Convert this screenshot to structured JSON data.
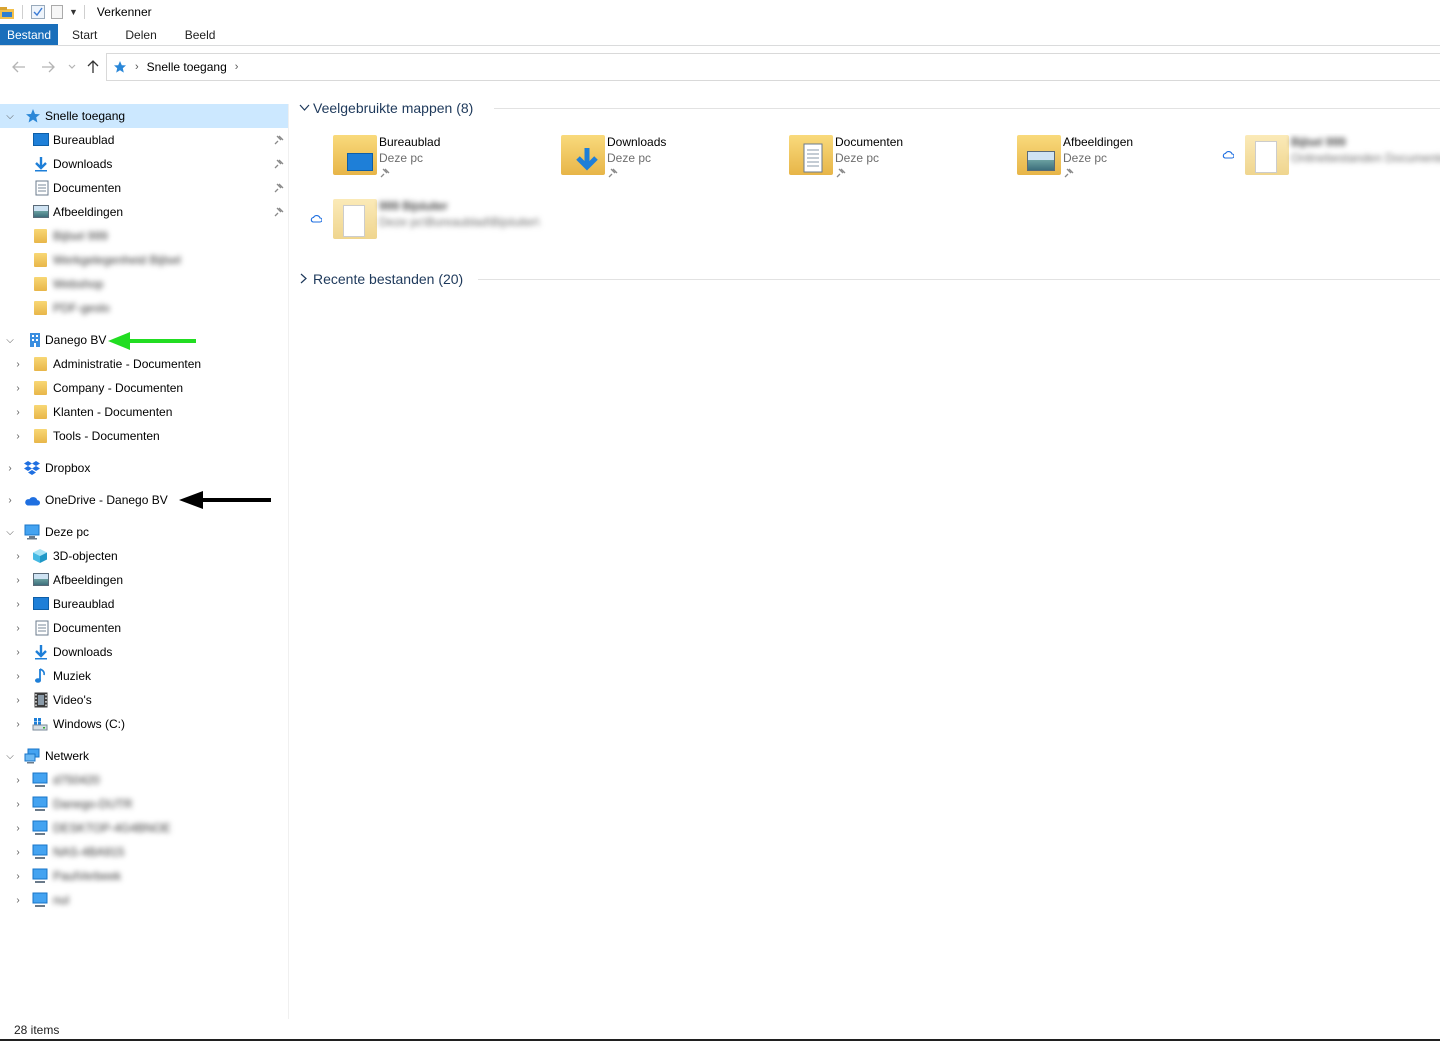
{
  "window": {
    "title": "Verkenner"
  },
  "ribbon": {
    "tabs": [
      "Bestand",
      "Start",
      "Delen",
      "Beeld"
    ]
  },
  "address": {
    "crumb": "Snelle toegang"
  },
  "nav": {
    "quick_access": "Snelle toegang",
    "quick_items": [
      {
        "label": "Bureaublad",
        "icon": "desktop-icon",
        "pinned": true
      },
      {
        "label": "Downloads",
        "icon": "downloads-icon",
        "pinned": true
      },
      {
        "label": "Documenten",
        "icon": "documents-icon",
        "pinned": true
      },
      {
        "label": "Afbeeldingen",
        "icon": "pictures-icon",
        "pinned": true
      },
      {
        "label": "Bijlsel 999",
        "icon": "folder-icon",
        "pinned": false
      },
      {
        "label": "Werkgelegenheid Bijlsel",
        "icon": "folder-icon",
        "pinned": false
      },
      {
        "label": "Webshop",
        "icon": "folder-icon",
        "pinned": false
      },
      {
        "label": "PDF-geslo",
        "icon": "folder-icon",
        "pinned": false
      }
    ],
    "org": "Danego BV",
    "org_items": [
      "Administratie - Documenten",
      "Company - Documenten",
      "Klanten - Documenten",
      "Tools - Documenten"
    ],
    "dropbox": "Dropbox",
    "onedrive": "OneDrive - Danego BV",
    "this_pc": "Deze pc",
    "pc_items": [
      "3D-objecten",
      "Afbeeldingen",
      "Bureaublad",
      "Documenten",
      "Downloads",
      "Muziek",
      "Video's",
      "Windows (C:)"
    ],
    "network": "Netwerk",
    "network_items": [
      "d750420",
      "Danego-DUTR",
      "DESKTOP-4G4BNOE",
      "NAS-4BA915",
      "PaulVerbeek",
      "nul"
    ]
  },
  "content": {
    "frequent_header": "Veelgebruikte mappen (8)",
    "recent_header": "Recente bestanden (20)",
    "frequent": [
      {
        "name": "Bureaublad",
        "sub": "Deze pc",
        "pinned": true
      },
      {
        "name": "Downloads",
        "sub": "Deze pc",
        "pinned": true
      },
      {
        "name": "Documenten",
        "sub": "Deze pc",
        "pinned": true
      },
      {
        "name": "Afbeeldingen",
        "sub": "Deze pc",
        "pinned": true
      },
      {
        "name": "Bijlsel 999",
        "sub": "Onlinebestanden Documenten",
        "pinned": false
      },
      {
        "name": "999 Bijsluiter",
        "sub": "Deze pc\\Bureaublad\\Bijsluiter\\",
        "pinned": false
      }
    ]
  },
  "status": {
    "items": "28 items"
  },
  "colors": {
    "accent": "#1a6fbb",
    "selected": "#cce8ff",
    "group_header": "#1e395b",
    "annotation_green": "#22dd22",
    "annotation_black": "#000000"
  }
}
